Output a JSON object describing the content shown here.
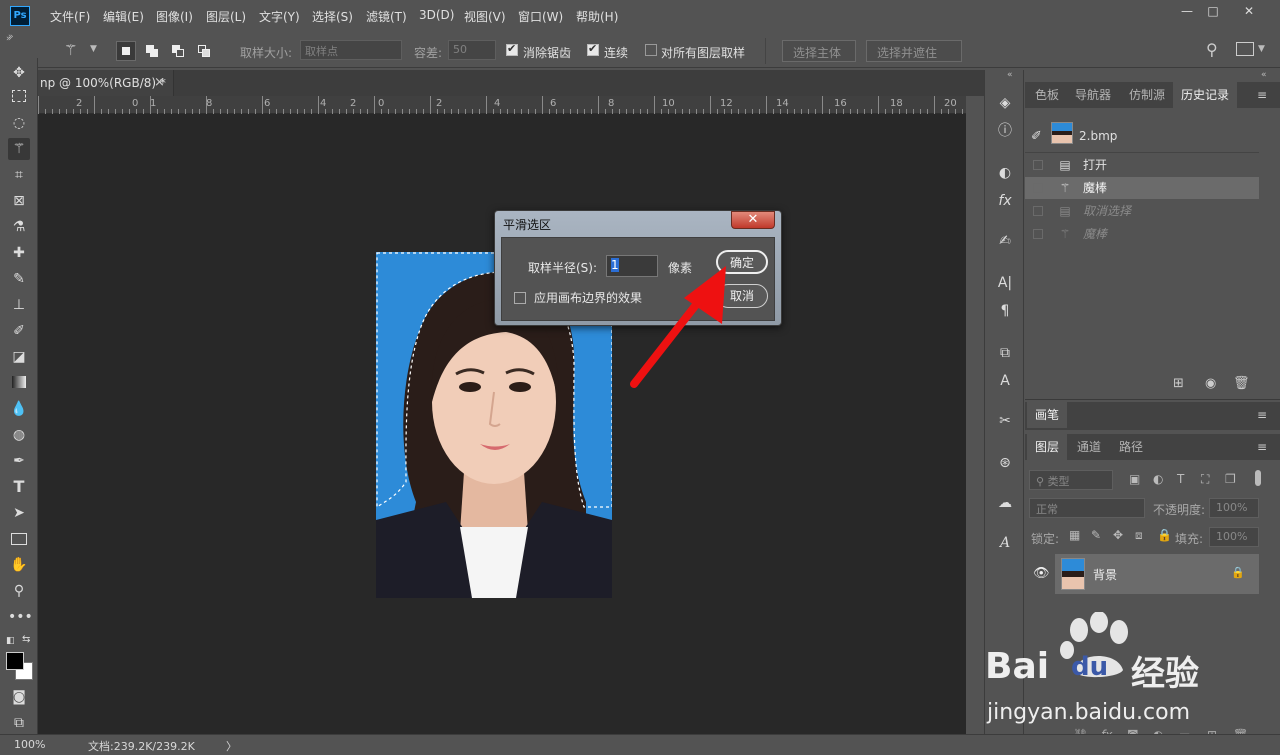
{
  "app": {
    "logo": "Ps"
  },
  "menubar": {
    "items": [
      "文件(F)",
      "编辑(E)",
      "图像(I)",
      "图层(L)",
      "文字(Y)",
      "选择(S)",
      "滤镜(T)",
      "3D(D)",
      "视图(V)",
      "窗口(W)",
      "帮助(H)"
    ]
  },
  "window_controls": {
    "minimize": "—",
    "restore": "□",
    "close": "✕"
  },
  "options": {
    "sample_size_label": "取样大小:",
    "sample_size_value": "取样点",
    "tolerance_label": "容差:",
    "tolerance_value": "50",
    "antialias_label": "消除锯齿",
    "antialias_checked": true,
    "contiguous_label": "连续",
    "contiguous_checked": true,
    "sample_all_label": "对所有图层取样",
    "sample_all_checked": false,
    "select_subject": "选择主体",
    "select_mask": "选择并遮住 ..."
  },
  "document": {
    "tab_title": "np @ 100%(RGB/8) *",
    "tab_close": "×",
    "ruler_labels": [
      "2",
      "0",
      "1",
      "8",
      "6",
      "4",
      "2",
      "0",
      "2",
      "4",
      "6",
      "8",
      "10",
      "12",
      "14",
      "16",
      "18",
      "20"
    ]
  },
  "dialog": {
    "title": "平滑选区",
    "close": "✕",
    "radius_label": "取样半径(S):",
    "radius_value": "1",
    "unit": "像素",
    "ok": "确定",
    "cancel": "取消",
    "canvas_edge_label": "应用画布边界的效果",
    "canvas_edge_checked": false
  },
  "history_panel": {
    "tabs": [
      "色板",
      "导航器",
      "仿制源",
      "历史记录"
    ],
    "active_tab": "历史记录",
    "snapshot": "2.bmp",
    "items": [
      {
        "label": "打开",
        "icon": "document-icon",
        "state": "normal"
      },
      {
        "label": "魔棒",
        "icon": "magic-wand-icon",
        "state": "selected"
      },
      {
        "label": "取消选择",
        "icon": "document-icon",
        "state": "undone"
      },
      {
        "label": "魔棒",
        "icon": "magic-wand-icon",
        "state": "undone"
      }
    ]
  },
  "brush_panel": {
    "tab": "画笔"
  },
  "layers_panel": {
    "tabs": [
      "图层",
      "通道",
      "路径"
    ],
    "active_tab": "图层",
    "filter_placeholder": "类型",
    "blend_mode": "正常",
    "opacity_label": "不透明度:",
    "opacity_value": "100%",
    "lock_label": "锁定:",
    "fill_label": "填充:",
    "fill_value": "100%",
    "layers": [
      {
        "name": "背景",
        "visible": true,
        "locked": true
      }
    ]
  },
  "status": {
    "zoom": "100%",
    "doc_size": "文档:239.2K/239.2K",
    "arrow": "〉"
  },
  "watermark": {
    "brand_left": "Bai",
    "brand_right": "du",
    "brand_cn": "经验",
    "url": "jingyan.baidu.com"
  },
  "colors": {
    "accent": "#31a8ff",
    "photo_bg": "#2d8bd8",
    "arrow": "#ee1111"
  }
}
